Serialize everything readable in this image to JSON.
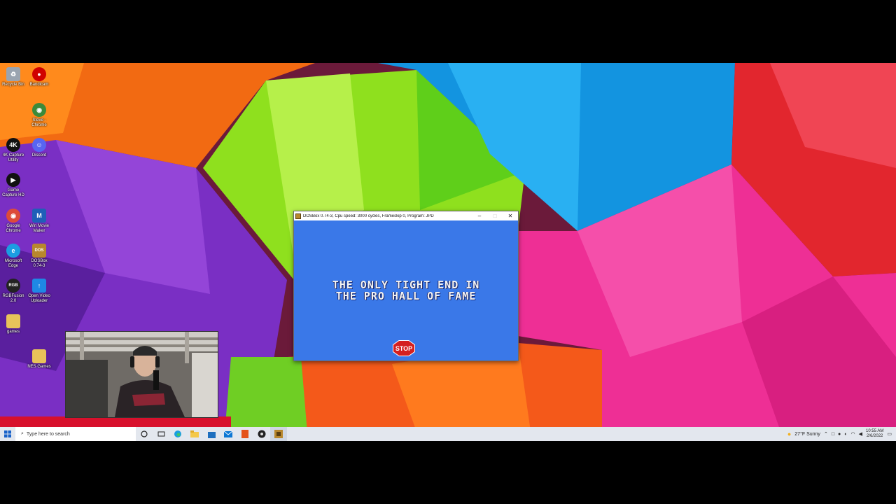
{
  "desktop": {
    "icons": [
      {
        "label": "Recycle Bin",
        "icon": "recycle-bin-icon",
        "color": "#9aa4b0",
        "glyph": "♻"
      },
      {
        "label": "Bandicam",
        "icon": "bandicam-icon",
        "color": "#d00000",
        "glyph": "●"
      },
      {
        "label": "Steve - Chrome",
        "icon": "chrome-icon",
        "color": "#3c8a3a",
        "glyph": "◉"
      },
      {
        "label": "4K Capture Utility",
        "icon": "capture-utility-icon",
        "color": "#111111",
        "glyph": "4K"
      },
      {
        "label": "Discord",
        "icon": "discord-icon",
        "color": "#5865f2",
        "glyph": "☺"
      },
      {
        "label": "Game Capture HD",
        "icon": "game-capture-icon",
        "color": "#111111",
        "glyph": "▶"
      },
      {
        "label": "Google Chrome",
        "icon": "chrome-icon",
        "color": "#dd4b39",
        "glyph": "◉"
      },
      {
        "label": "Win Movie Maker",
        "icon": "movie-maker-icon",
        "color": "#1f5fb8",
        "glyph": "M"
      },
      {
        "label": "Microsoft Edge",
        "icon": "edge-icon",
        "color": "#1b9de2",
        "glyph": "e"
      },
      {
        "label": "DOSBox 0.74-3",
        "icon": "dosbox-icon",
        "color": "#b8872d",
        "glyph": "DOS"
      },
      {
        "label": "RGBFusion 2.0",
        "icon": "rgbfusion-icon",
        "color": "#222222",
        "glyph": "RGB"
      },
      {
        "label": "Open Video Uploader",
        "icon": "video-uploader-icon",
        "color": "#1e88e5",
        "glyph": "↑"
      },
      {
        "label": "games",
        "icon": "folder-icon",
        "color": "#e8c35a",
        "glyph": ""
      },
      {
        "label": "NES Games",
        "icon": "folder-icon",
        "color": "#e8c35a",
        "glyph": ""
      }
    ]
  },
  "dosbox": {
    "title": "DOSBox 0.74-3, Cpu speed:    3000 cycles, Frameskip  0, Program:    JPD",
    "minimize": "–",
    "maximize": "□",
    "close": "✕",
    "game": {
      "line1": "THE ONLY TIGHT END IN",
      "line2": "THE PRO HALL OF FAME",
      "stop_label": "STOP"
    }
  },
  "taskbar": {
    "search_placeholder": "Type here to search",
    "weather": "27°F  Sunny",
    "time": "10:55 AM",
    "date": "2/6/2022"
  },
  "colors": {
    "game_bg": "#3a78e8",
    "taskbar_bg": "#e3e7ee"
  }
}
